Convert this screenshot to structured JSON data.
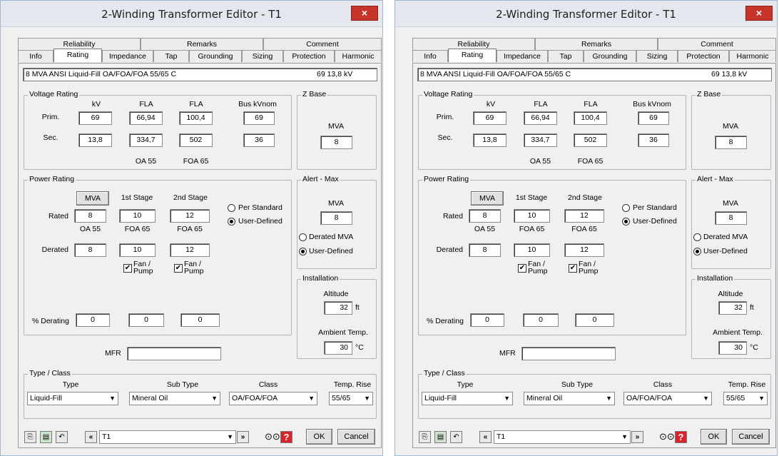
{
  "window_title": "2-Winding Transformer Editor - T1",
  "close_label": "×",
  "tabs_top": [
    "Reliability",
    "Remarks",
    "Comment"
  ],
  "tabs_bottom": [
    "Info",
    "Rating",
    "Impedance",
    "Tap",
    "Grounding",
    "Sizing",
    "Protection",
    "Harmonic"
  ],
  "description": "8 MVA ANSI Liquid-Fill OA/FOA/FOA 55/65 C",
  "desc_kv": "69   13,8 kV",
  "voltage_rating": {
    "label": "Voltage Rating",
    "col_kv": "kV",
    "col_fla1": "FLA",
    "col_fla2": "FLA",
    "col_bus": "Bus kVnom",
    "prim_label": "Prim.",
    "sec_label": "Sec.",
    "prim_kv": "69",
    "prim_fla1": "66,94",
    "prim_fla2": "100,4",
    "prim_bus": "69",
    "sec_kv": "13,8",
    "sec_fla1": "334,7",
    "sec_fla2": "502",
    "sec_bus": "36",
    "foot1": "OA 55",
    "foot2": "FOA 65"
  },
  "z_base": {
    "label": "Z Base",
    "mva_label": "MVA",
    "mva": "8"
  },
  "power_rating": {
    "label": "Power Rating",
    "mva_btn": "MVA",
    "stage1": "1st Stage",
    "stage2": "2nd Stage",
    "rated_label": "Rated",
    "rated": [
      "8",
      "10",
      "12"
    ],
    "class_labels": [
      "OA 55",
      "FOA 65",
      "FOA 65"
    ],
    "derated_label": "Derated",
    "derated": [
      "8",
      "10",
      "12"
    ],
    "fan_pump": "Fan / Pump",
    "per_standard": "Per Standard",
    "user_defined": "User-Defined",
    "pct_derating_label": "% Derating",
    "pct_derating": [
      "0",
      "0",
      "0"
    ]
  },
  "alert_max": {
    "label": "Alert - Max",
    "mva_label": "MVA",
    "mva": "8",
    "derated_mva": "Derated MVA",
    "user_defined": "User-Defined"
  },
  "installation": {
    "label": "Installation",
    "altitude_label": "Altitude",
    "altitude": "32",
    "altitude_unit": "ft",
    "ambient_label": "Ambient Temp.",
    "ambient": "30",
    "ambient_unit": "°C"
  },
  "mfr_label": "MFR",
  "mfr_value": "",
  "type_class": {
    "label": "Type / Class",
    "type_label": "Type",
    "subtype_label": "Sub Type",
    "class_label": "Class",
    "temprise_label": "Temp. Rise",
    "type": "Liquid-Fill",
    "subtype": "Mineral Oil",
    "class": "OA/FOA/FOA",
    "temprise": "55/65"
  },
  "toolbar": {
    "nav_value": "T1",
    "ok": "OK",
    "cancel": "Cancel",
    "help": "?"
  }
}
